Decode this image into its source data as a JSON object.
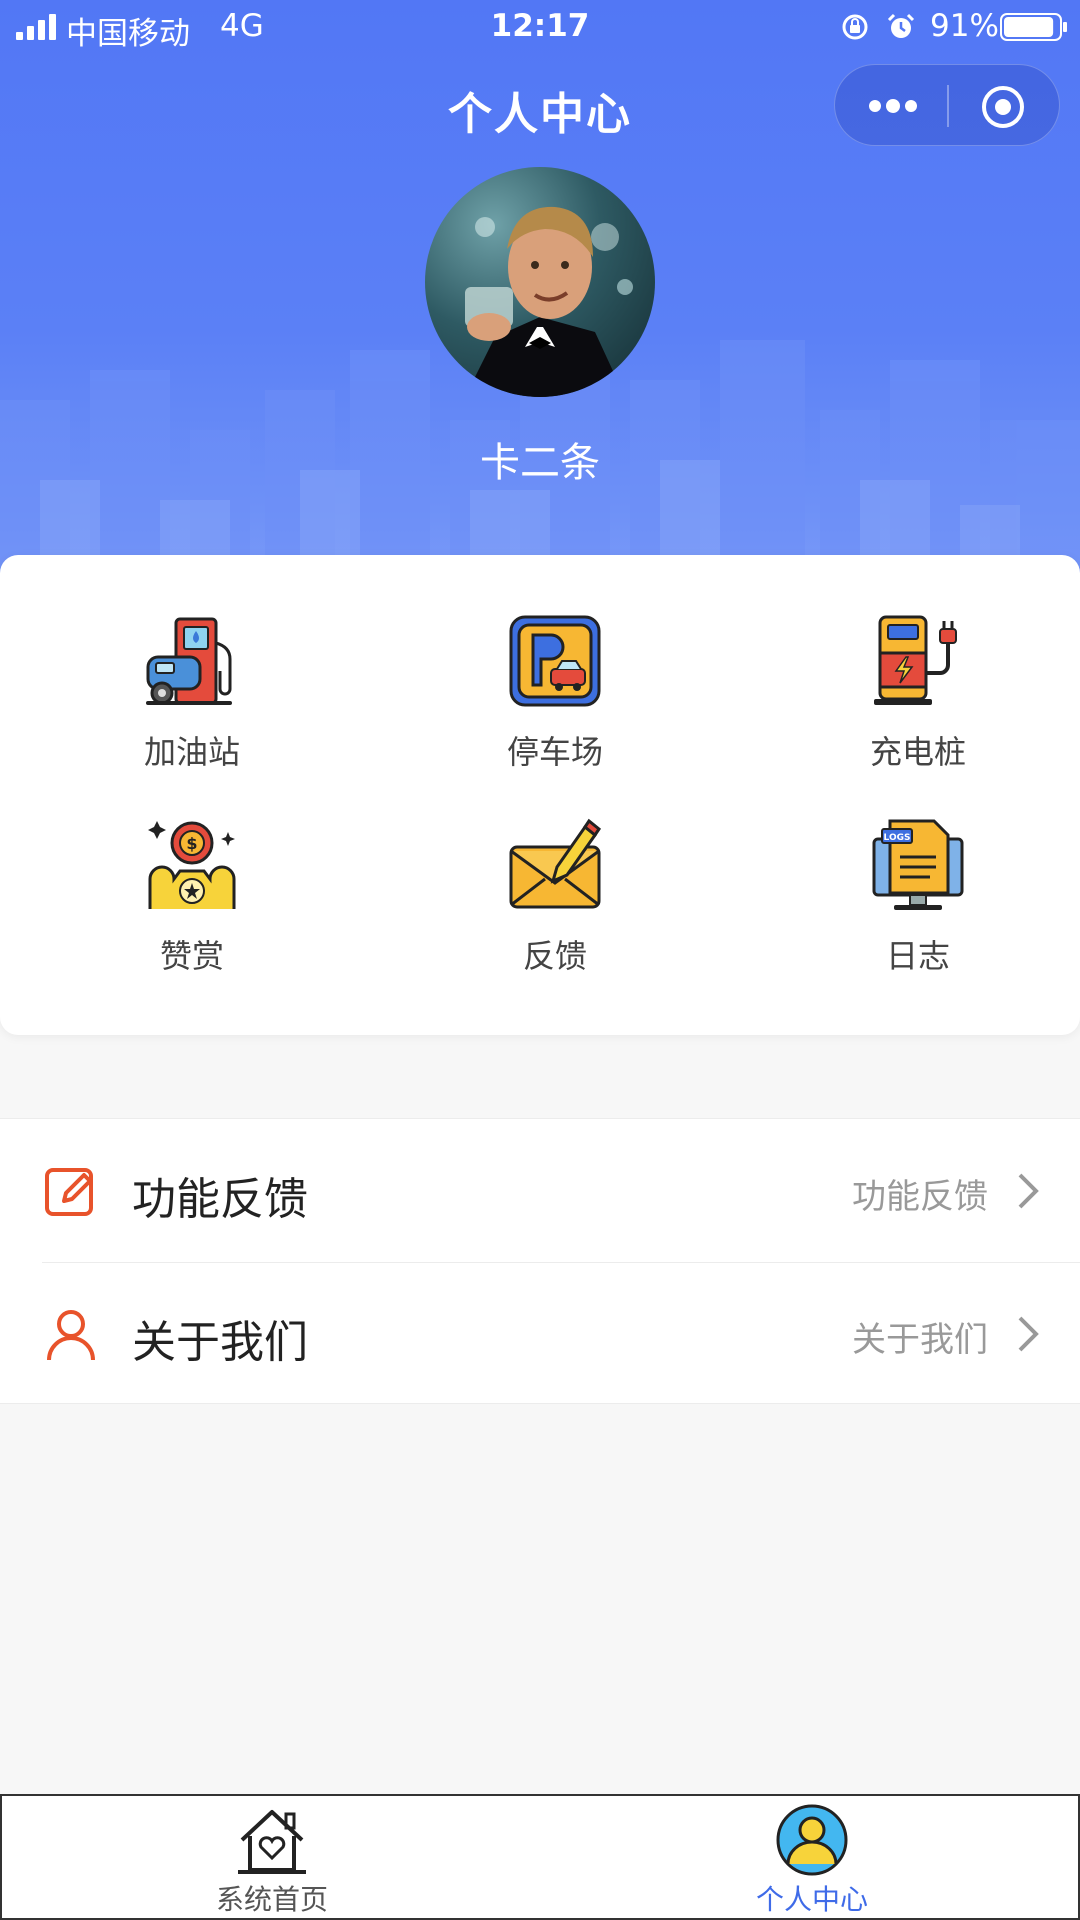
{
  "status_bar": {
    "carrier": "中国移动",
    "network": "4G",
    "time": "12:17",
    "battery_pct": "91%",
    "battery_level": 0.91
  },
  "nav": {
    "title": "个人中心",
    "more_icon": "more-dots-icon",
    "close_icon": "target-close-icon"
  },
  "profile": {
    "username": "卡二条",
    "avatar_icon": "user-avatar-photo"
  },
  "grid": {
    "items": [
      {
        "label": "加油站",
        "icon": "gas-station-icon"
      },
      {
        "label": "停车场",
        "icon": "parking-icon"
      },
      {
        "label": "充电桩",
        "icon": "charging-pile-icon"
      },
      {
        "label": "赞赏",
        "icon": "reward-icon"
      },
      {
        "label": "反馈",
        "icon": "feedback-mail-icon"
      },
      {
        "label": "日志",
        "icon": "logs-icon"
      }
    ]
  },
  "menu": {
    "items": [
      {
        "title": "功能反馈",
        "value": "功能反馈",
        "icon": "edit-icon"
      },
      {
        "title": "关于我们",
        "value": "关于我们",
        "icon": "user-icon"
      }
    ]
  },
  "tabbar": {
    "items": [
      {
        "label": "系统首页",
        "icon": "home-heart-icon",
        "active": false
      },
      {
        "label": "个人中心",
        "icon": "profile-icon",
        "active": true
      }
    ]
  },
  "colors": {
    "header_blue": "#5277f5",
    "accent_orange": "#e8532b",
    "tab_active": "#3f6be8",
    "tab_inactive": "#555555"
  }
}
